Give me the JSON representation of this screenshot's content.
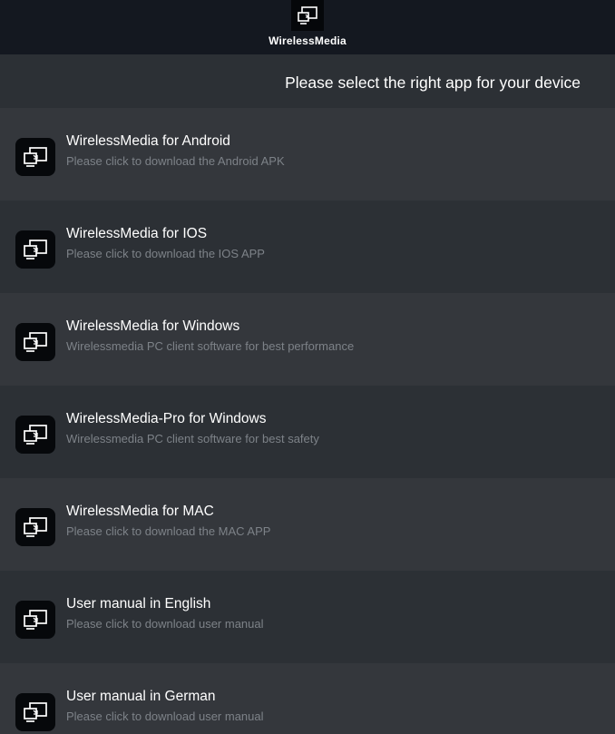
{
  "header": {
    "logo_icon": "screen-cast-icon",
    "brand": "WirelessMedia",
    "subtitle": "Please select the right app for your device"
  },
  "items": [
    {
      "title": "WirelessMedia for Android",
      "description": "Please click to download the Android APK",
      "icon": "screen-cast-icon"
    },
    {
      "title": "WirelessMedia for IOS",
      "description": "Please click to download the IOS APP",
      "icon": "screen-cast-icon"
    },
    {
      "title": "WirelessMedia for Windows",
      "description": "Wirelessmedia PC client software for best performance",
      "icon": "screen-cast-icon"
    },
    {
      "title": "WirelessMedia-Pro for Windows",
      "description": "Wirelessmedia PC client software for best safety",
      "icon": "screen-cast-icon"
    },
    {
      "title": "WirelessMedia for MAC",
      "description": "Please click to download the MAC APP",
      "icon": "screen-cast-icon"
    },
    {
      "title": "User manual in English",
      "description": "Please click to download user manual",
      "icon": "screen-cast-icon"
    },
    {
      "title": "User manual in German",
      "description": "Please click to download user manual",
      "icon": "screen-cast-icon"
    }
  ],
  "colors": {
    "topbar": "#141820",
    "row_light": "#34373c",
    "row_dark": "#2c3035",
    "title_text": "#ffffff",
    "description_text": "#7d8288"
  }
}
